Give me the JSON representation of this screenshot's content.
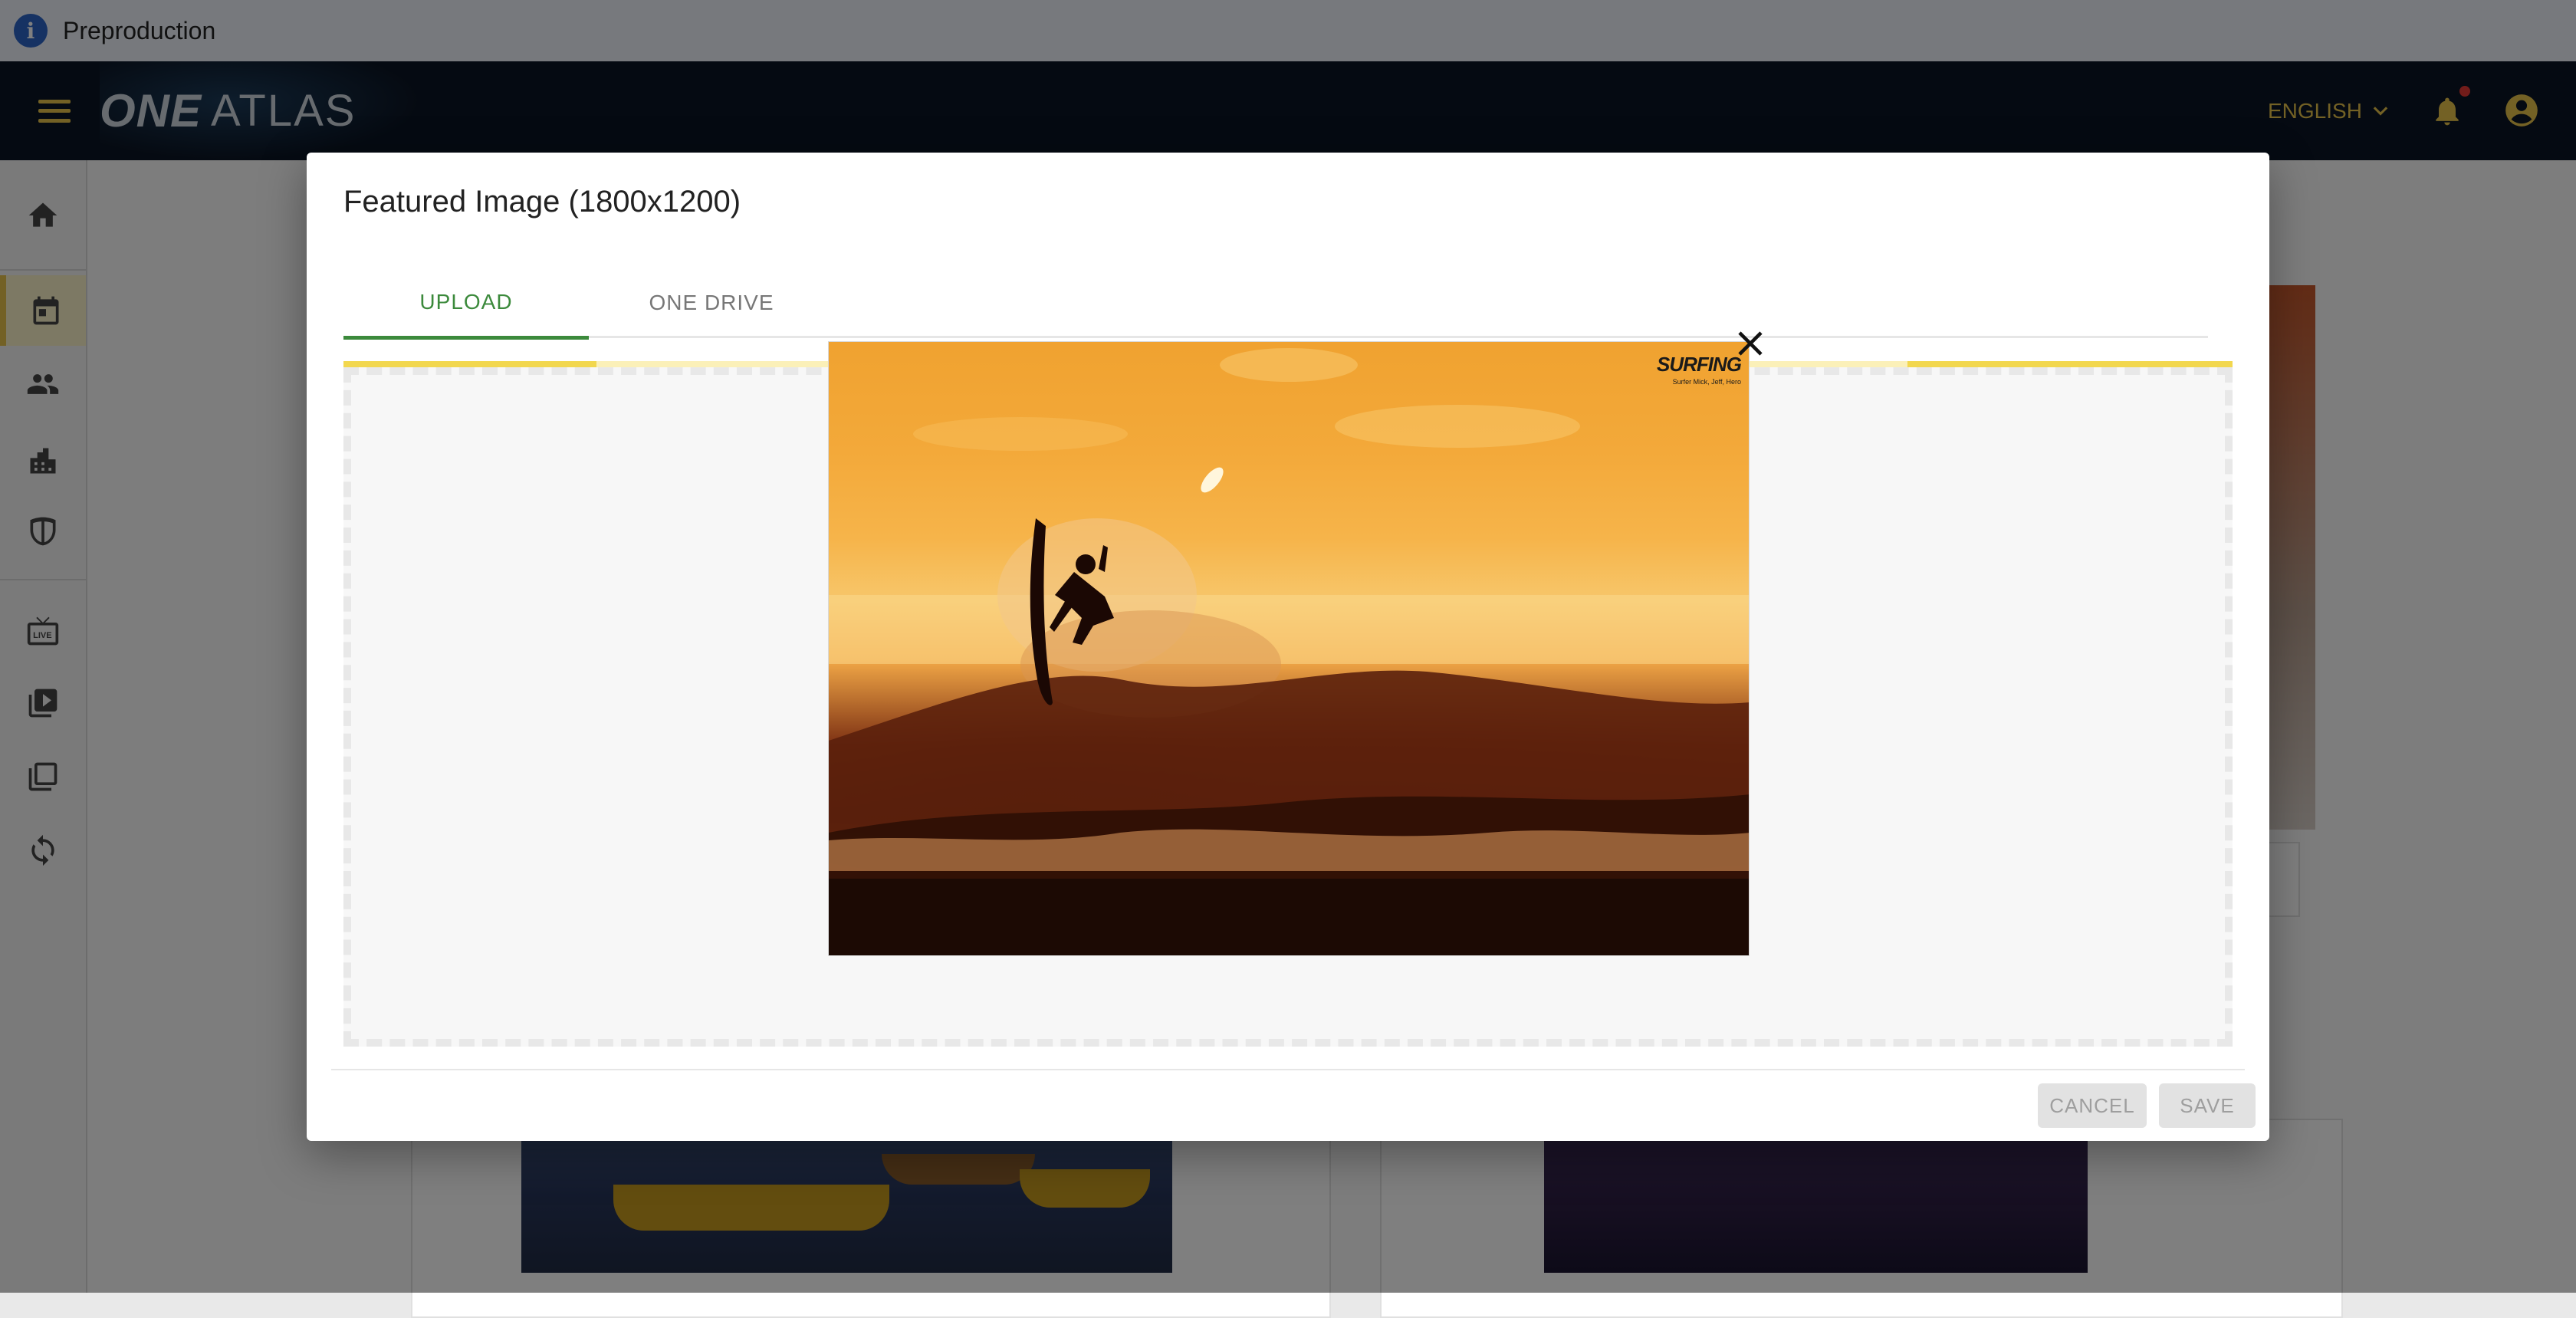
{
  "environment": {
    "label": "Preproduction",
    "icon": "info-icon"
  },
  "app_bar": {
    "logo_one": "ONE",
    "logo_atlas": "ATLAS",
    "language": "ENGLISH",
    "icons": [
      "menu-icon",
      "chevron-down-icon",
      "bell-icon",
      "account-circle-icon"
    ],
    "accent_color": "#e7c24a",
    "background_color": "#0b1524"
  },
  "side_nav": {
    "items": [
      {
        "icon": "home-icon",
        "active": false
      },
      {
        "icon": "calendar-icon",
        "active": true
      },
      {
        "icon": "people-icon",
        "active": false
      },
      {
        "icon": "buildings-icon",
        "active": false
      },
      {
        "icon": "shield-icon",
        "active": false
      },
      {
        "icon": "live-tv-icon",
        "active": false
      },
      {
        "icon": "video-library-icon",
        "active": false
      },
      {
        "icon": "photo-library-icon",
        "active": false
      },
      {
        "icon": "sync-icon",
        "active": false
      }
    ]
  },
  "dialog": {
    "title": "Featured Image (1800x1200)",
    "tabs": [
      {
        "label": "UPLOAD",
        "active": true
      },
      {
        "label": "ONE DRIVE",
        "active": false
      }
    ],
    "preview": {
      "watermark_main": "SURFING",
      "watermark_sub": "Surfer Mick, Jeff, Hero"
    },
    "buttons": {
      "cancel": "CANCEL",
      "save": "SAVE"
    },
    "colors": {
      "active_tab": "#3c8a3c",
      "progress": "#f2d74e",
      "progress_track": "#fbf0b8"
    }
  }
}
